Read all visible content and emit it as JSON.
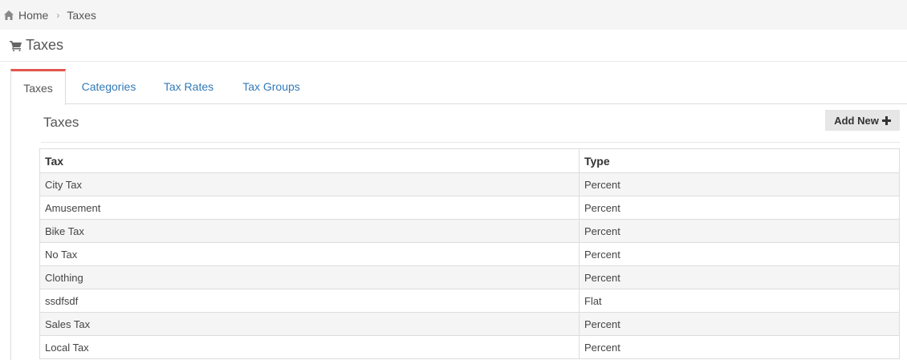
{
  "breadcrumb": {
    "items": [
      "Home",
      "Taxes"
    ]
  },
  "header": {
    "title": "Taxes",
    "icon": "cart-icon"
  },
  "tabs": [
    {
      "label": "Taxes",
      "active": true
    },
    {
      "label": "Categories",
      "active": false
    },
    {
      "label": "Tax Rates",
      "active": false
    },
    {
      "label": "Tax Groups",
      "active": false
    }
  ],
  "section": {
    "title": "Taxes",
    "add_label": "Add New"
  },
  "table": {
    "columns": [
      "Tax",
      "Type"
    ],
    "rows": [
      [
        "City Tax",
        "Percent"
      ],
      [
        "Amusement",
        "Percent"
      ],
      [
        "Bike Tax",
        "Percent"
      ],
      [
        "No Tax",
        "Percent"
      ],
      [
        "Clothing",
        "Percent"
      ],
      [
        "ssdfsdf",
        "Flat"
      ],
      [
        "Sales Tax",
        "Percent"
      ],
      [
        "Local Tax",
        "Percent"
      ]
    ]
  },
  "colors": {
    "link": "#337ab7",
    "active_tab_accent": "#e0584e"
  }
}
